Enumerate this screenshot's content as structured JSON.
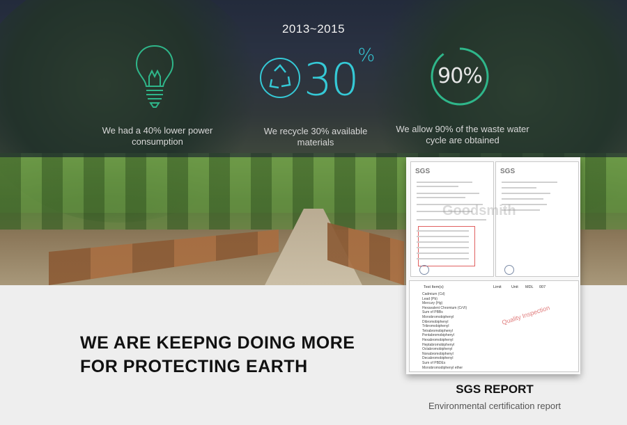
{
  "hero": {
    "year_range": "2013~2015",
    "stats": [
      {
        "icon": "lightbulb-icon",
        "caption_1": "We had a 40% lower power",
        "caption_2": "consumption"
      },
      {
        "icon": "recycle-icon",
        "value": "30",
        "unit": "%",
        "caption_1": "We recycle 30% available",
        "caption_2": "materials"
      },
      {
        "icon": "ring-gauge-icon",
        "value": "90%",
        "caption_1": "We allow 90% of the waste water",
        "caption_2": "cycle are obtained"
      }
    ]
  },
  "report": {
    "logo": "SGS",
    "watermark": "Goodsmith",
    "stamp": "Quality Inspection",
    "title": "SGS REPORT",
    "subtitle": "Environmental certification report",
    "table_header": [
      "Test Item(s)",
      "Limit",
      "Unit",
      "MDL",
      "007"
    ],
    "table_rows": [
      "Cadmium (Cd)",
      "Lead (Pb)",
      "Mercury (Hg)",
      "Hexavalent Chromium (CrVI)",
      "Sum of PBBs",
      "Monobromobiphenyl",
      "Dibromobiphenyl",
      "Tribromobiphenyl",
      "Tetrabromobiphenyl",
      "Pentabromobiphenyl",
      "Hexabromobiphenyl",
      "Heptabromobiphenyl",
      "Octabromobiphenyl",
      "Nonabromobiphenyl",
      "Decabromobiphenyl",
      "Sum of PBDEs",
      "Monobromodiphenyl ether"
    ]
  },
  "headline": {
    "line1": "WE ARE KEEPNG DOING MORE",
    "line2": "FOR PROTECTING EARTH"
  },
  "colors": {
    "accent_cyan": "#35c9d6",
    "accent_green": "#2fb68a"
  }
}
